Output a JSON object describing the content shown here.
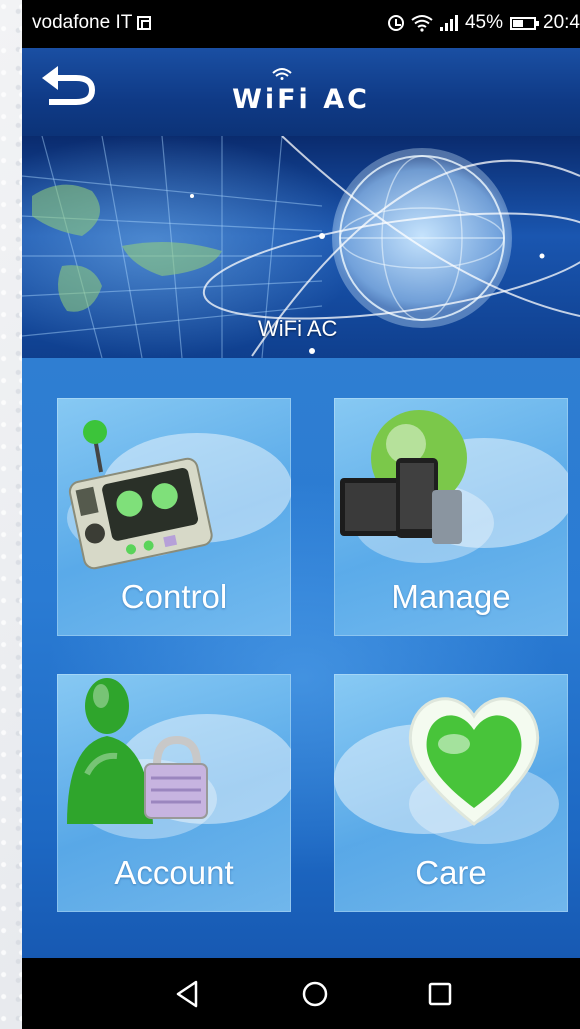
{
  "status_bar": {
    "carrier": "vodafone IT",
    "battery": "45%",
    "time": "20:4"
  },
  "header": {
    "title": "WiFi AC",
    "title_display": "WiFi AC"
  },
  "banner": {
    "caption": "WiFi AC"
  },
  "menu": {
    "tiles": [
      {
        "label": "Control",
        "icon": "control-panel-icon"
      },
      {
        "label": "Manage",
        "icon": "devices-globe-icon"
      },
      {
        "label": "Account",
        "icon": "user-lock-icon"
      },
      {
        "label": "Care",
        "icon": "heart-icon"
      }
    ]
  },
  "nav": {
    "back_icon": "triangle-back-icon",
    "home_icon": "circle-home-icon",
    "recents_icon": "square-recents-icon"
  },
  "colors": {
    "header_blue": "#1a4fa3",
    "tile_blue": "#8ccdf5",
    "accent_green": "#3cc43a"
  }
}
